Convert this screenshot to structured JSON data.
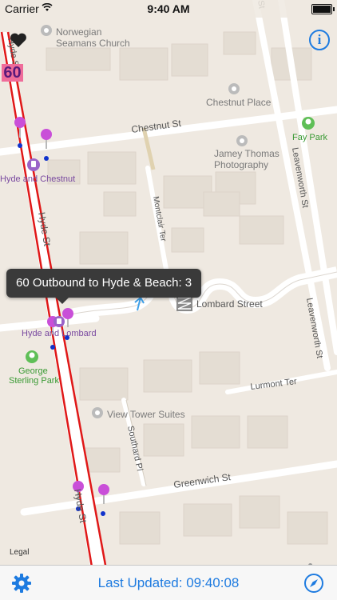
{
  "status_bar": {
    "carrier": "Carrier",
    "time": "9:40 AM"
  },
  "map": {
    "streets": {
      "hyde_upper": "Hyde St",
      "hyde_lower": "Hyde St",
      "chestnut": "Chestnut St",
      "montclair": "Montclair Ter",
      "leavenworth_upper": "Leavenworth St",
      "leavenworth_lower": "Leavenworth St",
      "lombard": "Lombard Street",
      "lurmont": "Lurmont Ter",
      "southard": "Southard Pl",
      "greenwich": "Greenwich St"
    },
    "places": {
      "norwegian": "Norwegian Seamans Church",
      "chestnut_place": "Chestnut Place",
      "fay_park": "Fay Park",
      "jamey_thomas": "Jamey Thomas Photography",
      "view_tower": "View Tower Suites",
      "george_sterling": "George Sterling Park",
      "hyde_chestnut": "Hyde and Chestnut",
      "hyde_lombard": "Hyde and Lombard"
    }
  },
  "route_badge": "60",
  "callout": {
    "text": "60 Outbound to Hyde & Beach: 3"
  },
  "legal": "Legal",
  "toolbar": {
    "last_updated": "Last Updated: 09:40:08"
  },
  "colors": {
    "accent": "#1e7be0",
    "route_line": "#e01818",
    "stop_pin": "#c94fd8"
  }
}
